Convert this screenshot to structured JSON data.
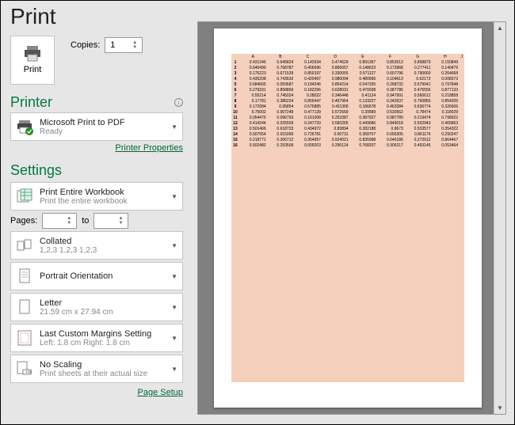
{
  "title": "Print",
  "printBtn": {
    "label": "Print"
  },
  "copies": {
    "label": "Copies:",
    "value": "1"
  },
  "printer": {
    "header": "Printer",
    "name": "Microsoft Print to PDF",
    "status": "Ready",
    "propertiesLink": "Printer Properties"
  },
  "settings": {
    "header": "Settings",
    "what": {
      "main": "Print Entire Workbook",
      "sub": "Print the entire workbook"
    },
    "pages": {
      "label": "Pages:",
      "to": "to"
    },
    "collate": {
      "main": "Collated",
      "sub": "1,2,3    1,2,3    1,2,3"
    },
    "orientation": {
      "main": "Portrait Orientation"
    },
    "paper": {
      "main": "Letter",
      "sub": "21.59 cm x 27.94 cm"
    },
    "margins": {
      "main": "Last Custom Margins Setting",
      "sub": "Left:  1.8 cm    Right:  1.8 cm"
    },
    "scaling": {
      "main": "No Scaling",
      "sub": "Print sheets at their actual size"
    },
    "pageSetupLink": "Page Setup"
  },
  "sheet": {
    "cols": [
      "A",
      "B",
      "C",
      "D",
      "E",
      "F",
      "G",
      "H",
      "J"
    ],
    "rows": [
      [
        "1",
        "0.431346",
        "0.645824",
        "0.142634",
        "0.474629",
        "0.891357",
        "0.853513",
        "0.858879",
        "0.150849"
      ],
      [
        "2",
        "0.646499",
        "0.768787",
        "0.406696",
        "0.866057",
        "0.148623",
        "0.173968",
        "0.277411",
        "0.140479"
      ],
      [
        "3",
        "0.175223",
        "0.671539",
        "0.850197",
        "0.330055",
        "0.571127",
        "0.607796",
        "0.790669",
        "0.264668"
      ],
      [
        "4",
        "0.435208",
        "0.743632",
        "0.420497",
        "0.980094",
        "0.480996",
        "0.104613",
        "0.62172",
        "0.008373"
      ],
      [
        "5",
        "0.684665",
        "0.053687",
        "0.194246",
        "0.854214",
        "0.047205",
        "0.268732",
        "0.679041",
        "0.797848"
      ],
      [
        "6",
        "0.279331",
        "0.858869",
        "0.182296",
        "0.628031",
        "0.470938",
        "0.387786",
        "0.475556",
        "0.877133"
      ],
      [
        "7",
        "0.55214",
        "0.745024",
        "0.28022",
        "0.346448",
        "0.41124",
        "0.947991",
        "0.560612",
        "0.218858"
      ],
      [
        "8",
        "0.17781",
        "0.386224",
        "0.856447",
        "0.467964",
        "0.133227",
        "0.342637",
        "0.760855",
        "0.854205"
      ],
      [
        "9",
        "0.172084",
        "0.95854",
        "0.576885",
        "0.411300",
        "0.186678",
        "0.463384",
        "0.636774",
        "0.326606"
      ],
      [
        "10",
        "0.75002",
        "0.907248",
        "0.477139",
        "0.572669",
        "0.39589",
        "0.530562",
        "0.78474",
        "0.118929"
      ],
      [
        "11",
        "0.054475",
        "0.096793",
        "0.161008",
        "0.253387",
        "0.387927",
        "0.987789",
        "0.219474",
        "0.798922"
      ],
      [
        "12",
        "0.414244",
        "0.025509",
        "0.247733",
        "0.560265",
        "0.449686",
        "0.849018",
        "0.502943",
        "0.465863"
      ],
      [
        "13",
        "0.501466",
        "0.618733",
        "0.434972",
        "0.83894",
        "0.282188",
        "0.8673",
        "0.533577",
        "0.354322"
      ],
      [
        "14",
        "0.507554",
        "0.915099",
        "0.726781",
        "0.00731",
        "0.358707",
        "0.056305",
        "0.861176",
        "0.290247"
      ],
      [
        "15",
        "0.218771",
        "0.306712",
        "0.354957",
        "0.924021",
        "0.835998",
        "0.646186",
        "0.272012",
        "0.864467"
      ],
      [
        "16",
        "0.502482",
        "0.253509",
        "0.009203",
        "0.290124",
        "0.768207",
        "0.305217",
        "0.493145",
        "0.053464"
      ]
    ]
  }
}
